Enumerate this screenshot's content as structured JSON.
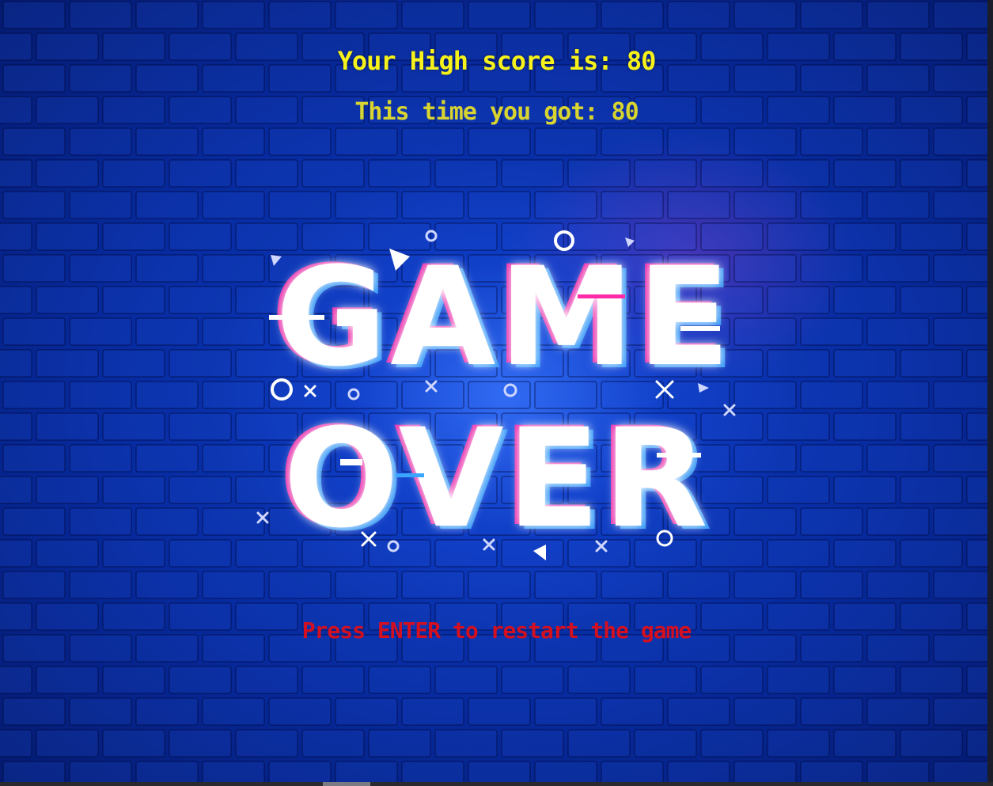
{
  "hud": {
    "high_score_text": "Your High score is: 80",
    "current_score_text": "This time you got: 80",
    "restart_hint": "Press ENTER to restart the game"
  },
  "title_art": {
    "line1": "GAME",
    "line2": "OVER"
  },
  "colors": {
    "high_score": "#f7f21a",
    "current_score": "#d8d430",
    "restart_hint": "#d41020",
    "title_fill": "#ffffff",
    "glitch_magenta": "#ff2aa8",
    "glitch_cyan": "#3aa6ff",
    "background": "#07217a"
  },
  "decorations": {
    "circle_icon": "ring-shape",
    "triangle_icon": "triangle-shape",
    "cross_icon": "x-cross-shape"
  }
}
